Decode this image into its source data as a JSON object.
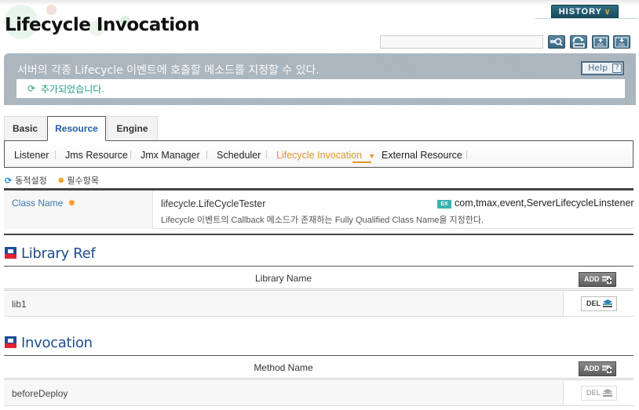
{
  "header": {
    "title": "Lifecycle Invocation",
    "history_label": "HISTORY",
    "search": {
      "value": "",
      "placeholder": ""
    },
    "tools": [
      {
        "icon": "search-icon",
        "label": "search"
      },
      {
        "icon": "refresh-icon",
        "label": "refresh"
      },
      {
        "icon": "xml-import-icon",
        "label": "XML"
      },
      {
        "icon": "xml-export-icon",
        "label": "XML"
      }
    ]
  },
  "banner": {
    "description": "서버의 각종 Lifecycle 이벤트에 호출할 메소드를 지정할 수 있다.",
    "help_label": "Help",
    "help_icon": "?",
    "message": "추가되었습니다."
  },
  "tabs": [
    {
      "label": "Basic",
      "active": false
    },
    {
      "label": "Resource",
      "active": true
    },
    {
      "label": "Engine",
      "active": false
    }
  ],
  "subnav": [
    {
      "label": "Listener",
      "active": false
    },
    {
      "label": "Jms Resource",
      "active": false
    },
    {
      "label": "Jmx Manager",
      "active": false
    },
    {
      "label": "Scheduler",
      "active": false
    },
    {
      "label": "Lifecycle Invocation",
      "active": true
    },
    {
      "label": "External Resource",
      "active": false
    }
  ],
  "legend": {
    "dynamic_label": "동적설정",
    "required_label": "필수항목"
  },
  "form": {
    "class_name": {
      "label": "Class Name",
      "value": "lifecycle.LifeCycleTester",
      "description": "Lifecycle 이벤트의 Callback 메소드가 존재하는 Fully Qualified Class Name을 지정한다.",
      "example_badge": "EX",
      "example": "com,tmax,event,ServerLifecycleLinstener"
    }
  },
  "library_ref": {
    "title": "Library Ref",
    "column": "Library Name",
    "add_label": "ADD",
    "del_label": "DEL",
    "rows": [
      {
        "name": "lib1",
        "deletable": true
      }
    ]
  },
  "invocation": {
    "title": "Invocation",
    "column": "Method Name",
    "add_label": "ADD",
    "del_label": "DEL",
    "rows": [
      {
        "name": "beforeDeploy",
        "deletable": false
      }
    ]
  },
  "colors": {
    "accent_blue": "#1f4e8c",
    "active_orange": "#e0962a",
    "message_teal": "#2b9a8a",
    "required_orange": "#f39a1e"
  }
}
